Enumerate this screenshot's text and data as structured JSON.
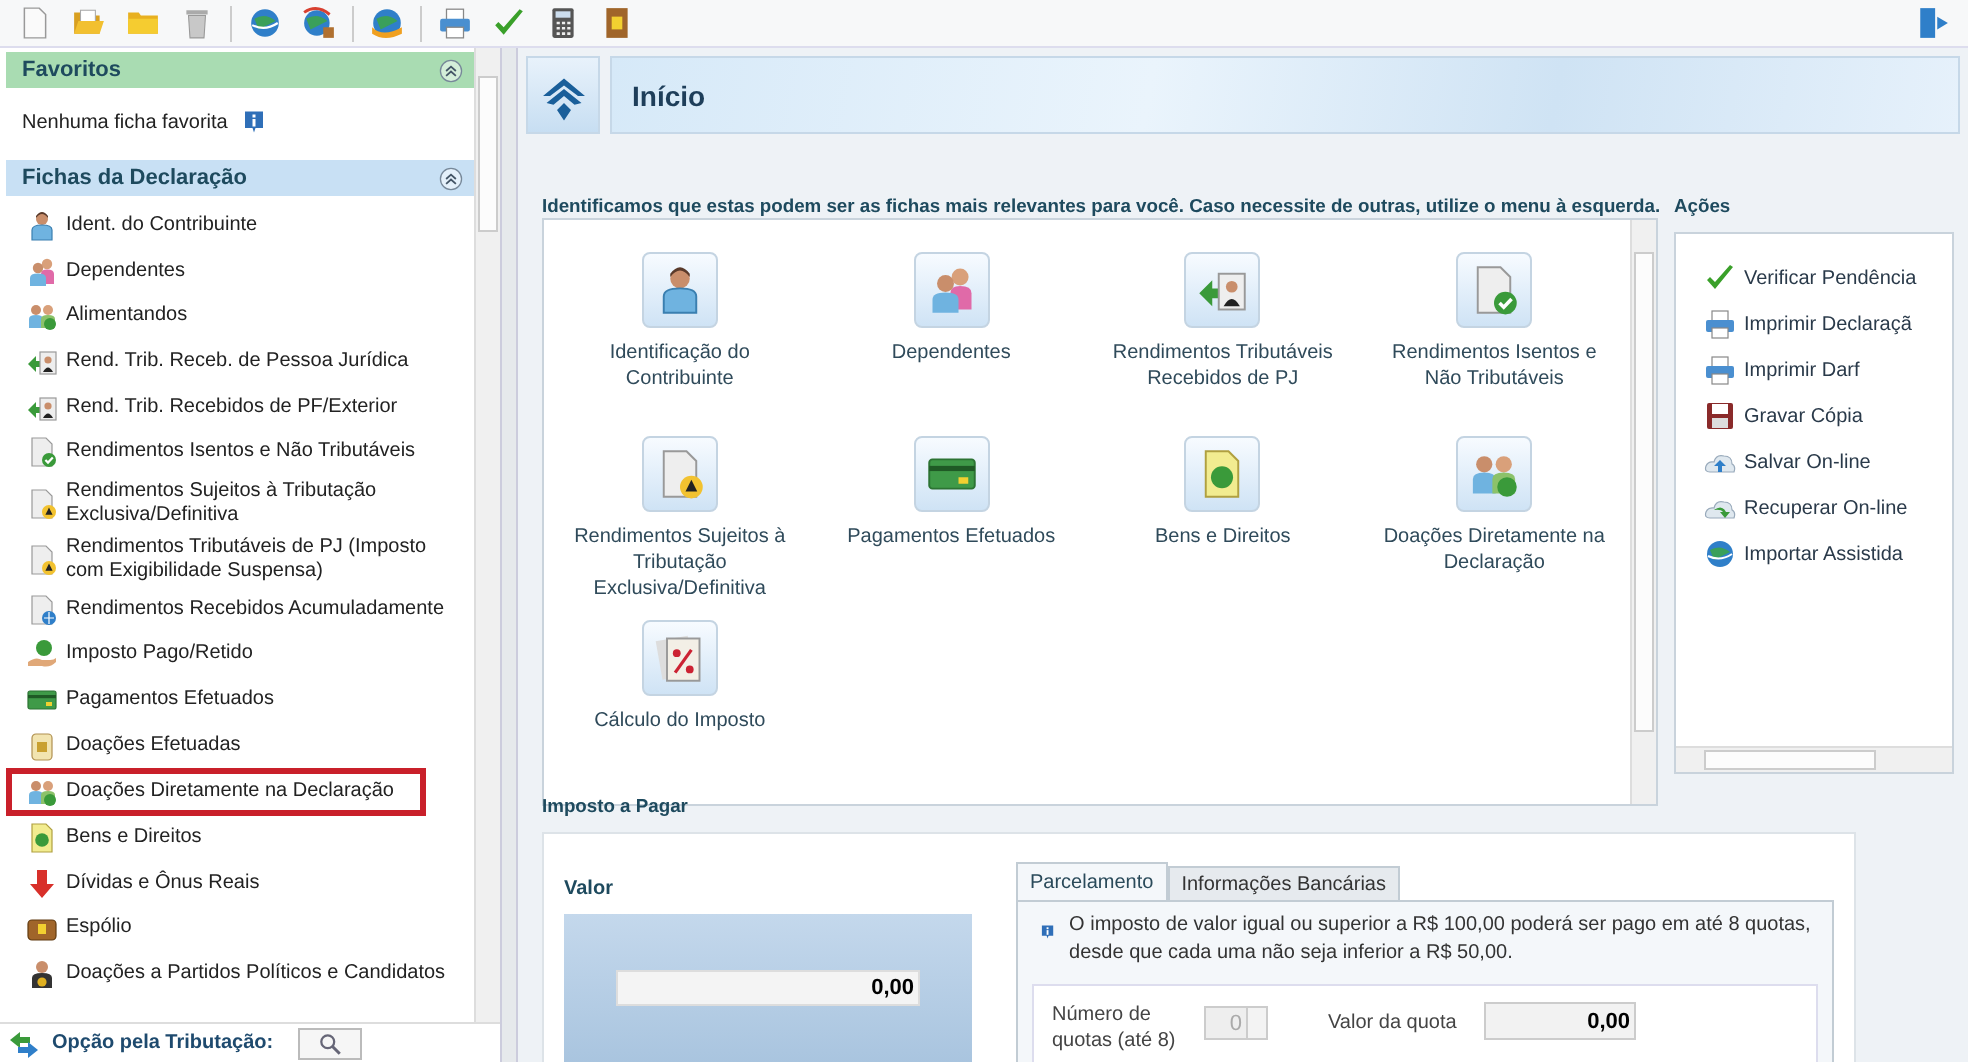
{
  "sidebar": {
    "favorites": {
      "title": "Favoritos",
      "empty_text": "Nenhuma ficha favorita"
    },
    "fichas": {
      "title": "Fichas da Declaração",
      "items": [
        {
          "label": "Ident. do Contribuinte",
          "selected": false
        },
        {
          "label": "Dependentes",
          "selected": false
        },
        {
          "label": "Alimentandos",
          "selected": false
        },
        {
          "label": "Rend. Trib. Receb. de Pessoa Jurídica",
          "selected": false
        },
        {
          "label": "Rend. Trib. Recebidos de PF/Exterior",
          "selected": false
        },
        {
          "label": "Rendimentos Isentos e Não Tributáveis",
          "selected": false
        },
        {
          "label": "Rendimentos Sujeitos à Tributação Exclusiva/Definitiva",
          "selected": false
        },
        {
          "label": "Rendimentos Tributáveis de PJ (Imposto com Exigibilidade Suspensa)",
          "selected": false
        },
        {
          "label": "Rendimentos Recebidos Acumuladamente",
          "selected": false
        },
        {
          "label": "Imposto Pago/Retido",
          "selected": false
        },
        {
          "label": "Pagamentos Efetuados",
          "selected": false
        },
        {
          "label": "Doações Efetuadas",
          "selected": false
        },
        {
          "label": "Doações Diretamente na Declaração",
          "selected": true
        },
        {
          "label": "Bens e Direitos",
          "selected": false
        },
        {
          "label": "Dívidas e Ônus Reais",
          "selected": false
        },
        {
          "label": "Espólio",
          "selected": false
        },
        {
          "label": "Doações a Partidos Políticos e Candidatos",
          "selected": false
        }
      ]
    },
    "footer_label": "Opção pela Tributação:"
  },
  "header": {
    "title": "Início"
  },
  "relevant": {
    "intro": "Identificamos que estas podem ser as fichas mais relevantes para você. Caso necessite de outras, utilize o menu à esquerda.",
    "items": [
      {
        "label": "Identificação do Contribuinte"
      },
      {
        "label": "Dependentes"
      },
      {
        "label": "Rendimentos Tributáveis Recebidos de PJ"
      },
      {
        "label": "Rendimentos Isentos e Não Tributáveis"
      },
      {
        "label": "Rendimentos Sujeitos à Tributação Exclusiva/Definitiva"
      },
      {
        "label": "Pagamentos Efetuados"
      },
      {
        "label": "Bens e Direitos"
      },
      {
        "label": "Doações Diretamente na Declaração"
      },
      {
        "label": "Cálculo do Imposto"
      }
    ]
  },
  "actions": {
    "title": "Ações",
    "items": [
      {
        "label": "Verificar Pendência"
      },
      {
        "label": "Imprimir Declaraçã"
      },
      {
        "label": "Imprimir Darf"
      },
      {
        "label": "Gravar Cópia"
      },
      {
        "label": "Salvar On-line"
      },
      {
        "label": "Recuperar On-line"
      },
      {
        "label": "Importar Assistida"
      }
    ]
  },
  "tax": {
    "title": "Imposto a Pagar",
    "value_label": "Valor",
    "value": "0,00",
    "tabs": [
      {
        "label": "Parcelamento",
        "selected": true
      },
      {
        "label": "Informações Bancárias",
        "selected": false
      }
    ],
    "info": "O imposto de valor igual ou superior a R$ 100,00 poderá ser pago em até 8 quotas, desde que cada uma não seja inferior a R$ 50,00.",
    "quotas_label": "Número de quotas (até 8)",
    "quotas_value": "0",
    "quotas_disabled": true,
    "quota_value_label": "Valor da quota",
    "quota_value": "0,00"
  }
}
